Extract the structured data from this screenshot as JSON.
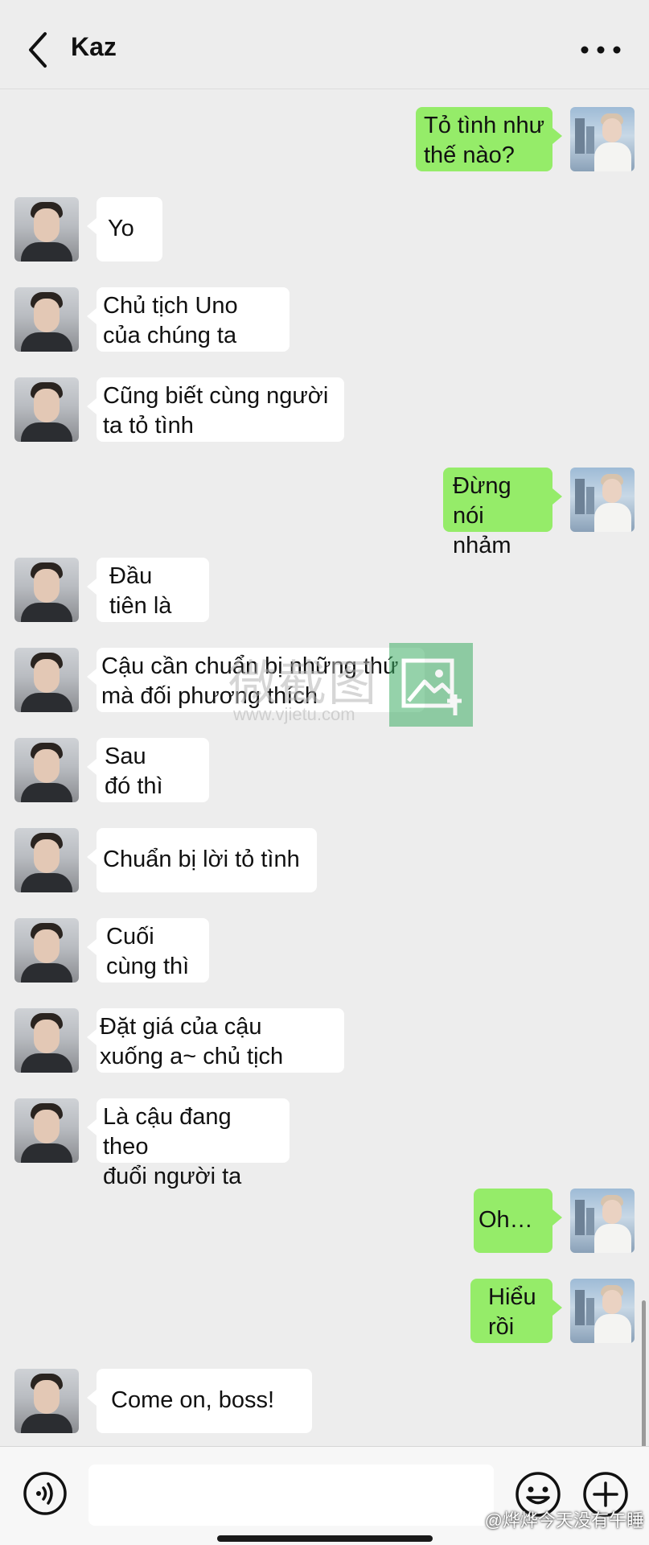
{
  "header": {
    "title": "Kaz"
  },
  "messages": [
    {
      "side": "right",
      "text": "Tỏ tình như\nthế nào?"
    },
    {
      "side": "left",
      "text": "Yo"
    },
    {
      "side": "left",
      "text": "Chủ tịch Uno\ncủa chúng ta"
    },
    {
      "side": "left",
      "text": "Cũng biết cùng người\nta tỏ tình"
    },
    {
      "side": "right",
      "text": "Đừng nói\nnhảm"
    },
    {
      "side": "left",
      "text": "Đầu\ntiên là"
    },
    {
      "side": "left",
      "text": "Cậu cần chuẩn bị những thứ\nmà đối phương thích"
    },
    {
      "side": "left",
      "text": "Sau\nđó thì"
    },
    {
      "side": "left",
      "text": "Chuẩn bị lời tỏ tình"
    },
    {
      "side": "left",
      "text": "Cuối\ncùng thì"
    },
    {
      "side": "left",
      "text": "Đặt giá của cậu\nxuống a~ chủ tịch"
    },
    {
      "side": "left",
      "text": "Là cậu đang theo\nđuổi người ta"
    },
    {
      "side": "right",
      "text": "Oh…"
    },
    {
      "side": "right",
      "text": "Hiểu\nrồi"
    },
    {
      "side": "left",
      "text": "Come on, boss!"
    }
  ],
  "watermark": {
    "text": "微截图",
    "url": "www.vjietu.com"
  },
  "input": {
    "value": "",
    "placeholder": ""
  },
  "credit": "@烨烨今天没有午睡",
  "icons": {
    "back": "chevron-left-icon",
    "more": "more-dots-icon",
    "voice": "voice-icon",
    "emoji": "emoji-icon",
    "plus": "plus-icon"
  },
  "colors": {
    "outgoing_bubble": "#95ec69",
    "incoming_bubble": "#ffffff",
    "background": "#ededed"
  }
}
